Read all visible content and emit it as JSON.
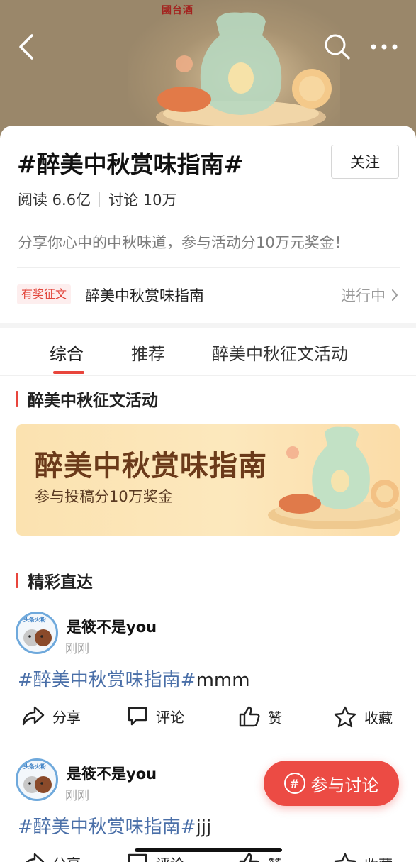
{
  "hero": {
    "brand": "國台酒"
  },
  "topic": {
    "title": "#醉美中秋赏味指南#",
    "follow_label": "关注",
    "read_label": "阅读 6.6亿",
    "discuss_label": "讨论 10万",
    "description": "分享你心中的中秋味道，参与活动分10万元奖金！"
  },
  "event": {
    "badge": "有奖征文",
    "name": "醉美中秋赏味指南",
    "status": "进行中"
  },
  "tabs": [
    {
      "label": "综合",
      "active": true
    },
    {
      "label": "推荐",
      "active": false
    },
    {
      "label": "醉美中秋征文活动",
      "active": false
    }
  ],
  "section_event": {
    "title": "醉美中秋征文活动"
  },
  "promo": {
    "title": "醉美中秋赏味指南",
    "subtitle": "参与投稿分10万奖金"
  },
  "section_highlights": {
    "title": "精彩直达"
  },
  "posts": [
    {
      "author": "是筱不是you",
      "avatar_badge": "头条火粉",
      "time": "刚刚",
      "tag": "#醉美中秋赏味指南#",
      "text": "mmm",
      "share": "分享",
      "comment": "评论",
      "like": "赞",
      "favorite": "收藏"
    },
    {
      "author": "是筱不是you",
      "avatar_badge": "头条火粉",
      "time": "刚刚",
      "tag": "#醉美中秋赏味指南#",
      "text": "jjj",
      "share": "分享",
      "comment": "评论",
      "like": "赞",
      "favorite": "收藏"
    }
  ],
  "fab": {
    "label": "参与讨论",
    "icon": "#"
  },
  "colors": {
    "accent": "#e8453c",
    "link": "#4a6fa8",
    "fab": "#ec4b44"
  }
}
